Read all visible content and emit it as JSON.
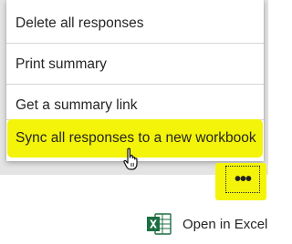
{
  "menu": {
    "items": [
      {
        "label": "Delete all responses"
      },
      {
        "label": "Print summary"
      },
      {
        "label": "Get a summary link"
      },
      {
        "label": "Sync all responses to a new workbook",
        "highlighted": true
      }
    ]
  },
  "more_button": {
    "label": "•••",
    "icon": "more-options-icon"
  },
  "open_in_excel": {
    "label": "Open in Excel",
    "icon": "excel-icon"
  },
  "colors": {
    "highlight": "#f4f40a",
    "excel_green": "#1d6f42",
    "background_band": "#e4e4e4"
  }
}
